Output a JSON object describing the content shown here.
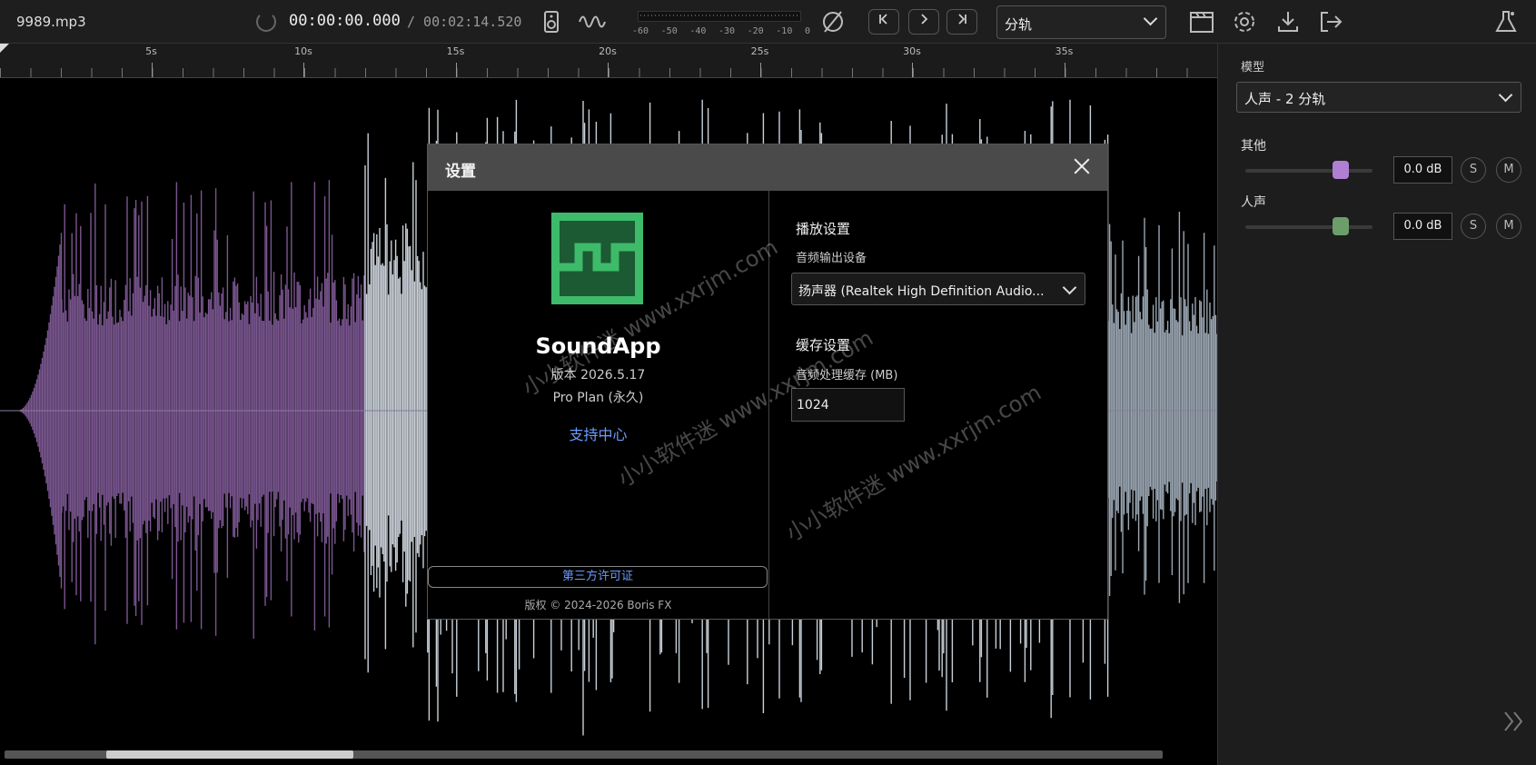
{
  "topbar": {
    "filename": "9989.mp3",
    "current_time": "00:00:00.000",
    "total_time": "/ 00:02:14.520",
    "meter_labels": [
      "-60",
      "-50",
      "-40",
      "-30",
      "-20",
      "-10",
      "0"
    ],
    "mode_value": "分轨"
  },
  "ruler": {
    "labels": [
      "5s",
      "10s",
      "15s",
      "20s",
      "25s",
      "30s",
      "35s"
    ]
  },
  "side": {
    "model_label": "模型",
    "model_value": "人声 - 2 分轨",
    "tracks": [
      {
        "name": "其他",
        "gain": "0.0 dB",
        "solo": "S",
        "mute": "M",
        "color": "#b07fd4",
        "level": 0.75
      },
      {
        "name": "人声",
        "gain": "0.0 dB",
        "solo": "S",
        "mute": "M",
        "color": "#6b9e6b",
        "level": 0.75
      }
    ]
  },
  "modal": {
    "title": "设置",
    "app_name": "SoundApp",
    "version": "版本 2026.5.17",
    "plan": "Pro Plan (永久)",
    "support": "支持中心",
    "license": "第三方许可证",
    "copyright": "版权 © 2024-2026 Boris FX",
    "playback_title": "播放设置",
    "device_label": "音频输出设备",
    "device_value": "扬声器 (Realtek High Definition Audio...",
    "cache_title": "缓存设置",
    "cache_label": "音频处理缓存 (MB)",
    "cache_value": "1024"
  },
  "watermark": [
    "小小软件迷 www.xxrjm.com",
    "小小软件迷 www.xxrjm.com",
    "小小软件迷 www.xxrjm.com"
  ],
  "colors": {
    "other_wave": "#7a5690",
    "vocal_wave": "#c8d0d8",
    "accent": "#6b9bff",
    "logo_green": "#3dbb6a"
  }
}
